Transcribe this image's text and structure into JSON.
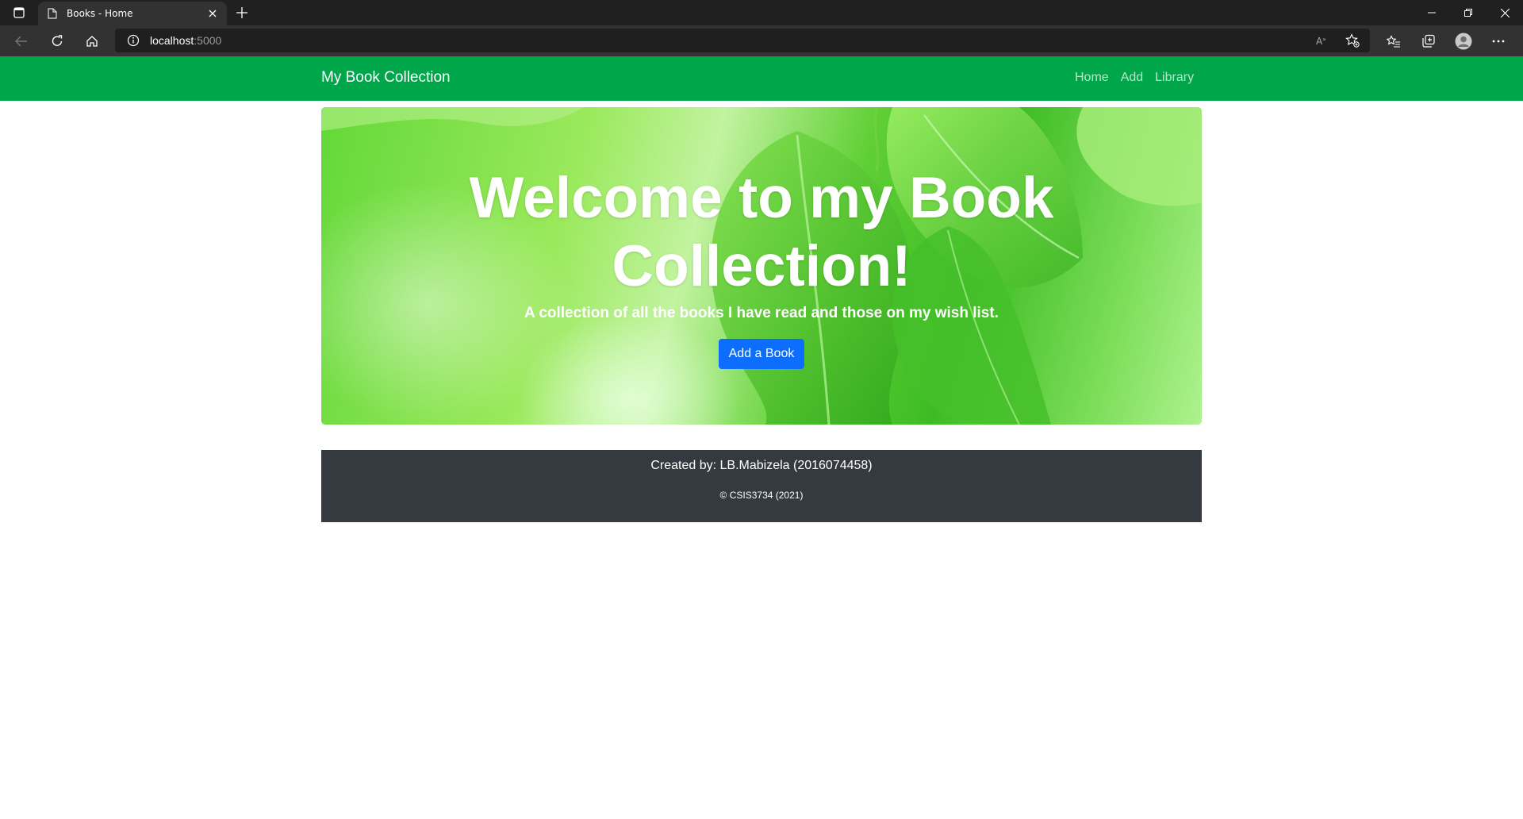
{
  "browser": {
    "tab": {
      "title": "Books - Home"
    },
    "address": {
      "host": "localhost",
      "port": ":5000"
    }
  },
  "navbar": {
    "brand": "My Book Collection",
    "links": [
      {
        "label": "Home"
      },
      {
        "label": "Add"
      },
      {
        "label": "Library"
      }
    ],
    "bg_color": "#00a64a"
  },
  "hero": {
    "title": "Welcome to my Book Collection!",
    "subtitle": "A collection of all the books I have read and those on my wish list.",
    "button_label": "Add a Book",
    "button_color": "#0d6efd"
  },
  "footer": {
    "created_by": "Created by: LB.Mabizela (2016074458)",
    "copyright": "© CSIS3734 (2021)",
    "bg_color": "#343a40"
  },
  "icons": {
    "tab_actions": "tab-actions-icon",
    "favicon": "page-icon",
    "close": "close-icon",
    "new_tab": "plus-icon",
    "back": "back-arrow-icon",
    "refresh": "refresh-icon",
    "home": "home-icon",
    "site_info": "info-icon",
    "read_aloud": "read-aloud-icon",
    "add_favorite": "add-favorite-icon",
    "favorites": "favorites-icon",
    "collections": "collections-icon",
    "profile": "profile-icon",
    "more": "more-icon"
  }
}
